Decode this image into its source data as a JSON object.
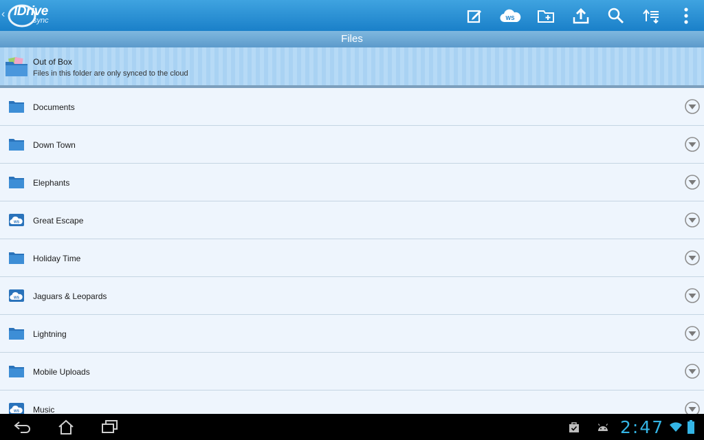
{
  "app": {
    "logo_text": "IDrive",
    "logo_subtext": "sync",
    "colors": {
      "accent": "#1a80c9",
      "title_bar": "#5c9acb",
      "clock": "#34b5e5"
    }
  },
  "toolbar": {
    "actions": [
      {
        "name": "compose-icon"
      },
      {
        "name": "ws-cloud-icon",
        "label": "WS"
      },
      {
        "name": "new-folder-icon"
      },
      {
        "name": "upload-icon"
      },
      {
        "name": "search-icon"
      },
      {
        "name": "sort-icon"
      },
      {
        "name": "overflow-menu-icon"
      }
    ]
  },
  "title": "Files",
  "out_of_box": {
    "title": "Out of Box",
    "subtitle": "Files in this folder are only synced to the cloud"
  },
  "items": [
    {
      "label": "Documents",
      "icon": "folder"
    },
    {
      "label": "Down Town",
      "icon": "folder"
    },
    {
      "label": "Elephants",
      "icon": "folder"
    },
    {
      "label": "Great Escape",
      "icon": "ws"
    },
    {
      "label": "Holiday Time",
      "icon": "folder"
    },
    {
      "label": "Jaguars & Leopards",
      "icon": "ws"
    },
    {
      "label": "Lightning",
      "icon": "folder"
    },
    {
      "label": "Mobile Uploads",
      "icon": "folder"
    },
    {
      "label": "Music",
      "icon": "ws"
    }
  ],
  "ws_badge": "WS",
  "status": {
    "time": "2:47"
  }
}
